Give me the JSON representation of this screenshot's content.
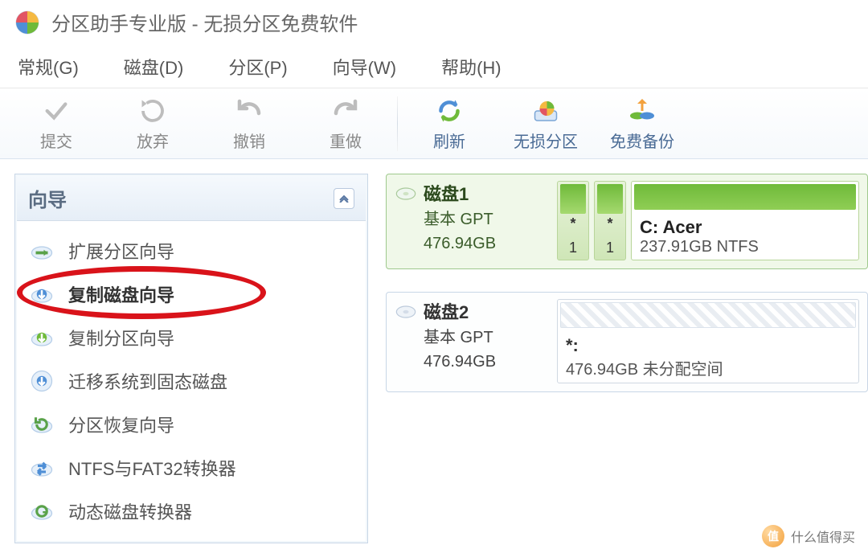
{
  "title": "分区助手专业版 - 无损分区免费软件",
  "menu": {
    "general": "常规(G)",
    "disk": "磁盘(D)",
    "partition": "分区(P)",
    "wizard": "向导(W)",
    "help": "帮助(H)"
  },
  "toolbar": {
    "submit": "提交",
    "discard": "放弃",
    "undo": "撤销",
    "redo": "重做",
    "refresh": "刷新",
    "lossless": "无损分区",
    "backup": "免费备份"
  },
  "sidebar": {
    "title": "向导",
    "items": [
      "扩展分区向导",
      "复制磁盘向导",
      "复制分区向导",
      "迁移系统到固态磁盘",
      "分区恢复向导",
      "NTFS与FAT32转换器",
      "动态磁盘转换器"
    ]
  },
  "disks": [
    {
      "name": "磁盘1",
      "type": "基本 GPT",
      "size": "476.94GB",
      "selected": true,
      "small_parts": [
        {
          "top": "*",
          "bottom": "1"
        },
        {
          "top": "*",
          "bottom": "1"
        }
      ],
      "main_part": {
        "label": "C: Acer",
        "size": "237.91GB NTFS"
      }
    },
    {
      "name": "磁盘2",
      "type": "基本 GPT",
      "size": "476.94GB",
      "selected": false,
      "empty_part": {
        "label": "*:",
        "size": "476.94GB 未分配空间"
      }
    }
  ],
  "watermark": "什么值得买"
}
